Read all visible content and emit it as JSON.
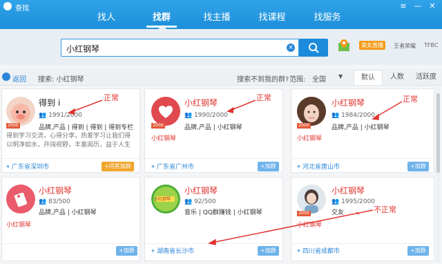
{
  "window": {
    "title": "查找",
    "ctrl_menu": "≡",
    "ctrl_min": "—",
    "ctrl_close": "✕"
  },
  "nav": {
    "tabs": [
      "找人",
      "找群",
      "找主播",
      "找课程",
      "找服务"
    ],
    "active": "找群"
  },
  "search": {
    "value": "小红钢琴",
    "clear_icon": "×"
  },
  "top_right": {
    "live": "美女直播",
    "hot1": "王者荣耀",
    "hot2": "TFBC"
  },
  "filter": {
    "back": "返回",
    "keyword": "搜索: 小红钢琴",
    "no_result": "搜索不到我的群?",
    "range_label": "范围:",
    "range_value": "全国",
    "sort_tabs": [
      "默认",
      "人数",
      "活跃度"
    ]
  },
  "cards": [
    {
      "name": "得到 i",
      "members": "1991/2000",
      "tags": "品牌,产品 | 得到 | 得到 | 得到专栏",
      "desc": "得到学习交流，心得分享，热爱学习让我们得以明净如水，开阔视野，丰富阅历，益于人生",
      "location": "广东省深圳市",
      "button": "+问答加群",
      "level": "2000"
    },
    {
      "name": "小红钢琴",
      "members": "1990/2000",
      "tags": "品牌,产品 | 小红钢琴",
      "location": "广东省广州市",
      "button": "+加群",
      "label": "小红钢琴",
      "level": "2000"
    },
    {
      "name": "小红钢琴",
      "members": "1984/2000",
      "tags": "品牌,产品 | 小红钢琴",
      "location": "河北省唐山市",
      "button": "+加群",
      "label": "小红钢琴",
      "level": "2000"
    },
    {
      "name": "小红钢琴",
      "members": "83/500",
      "tags": "品牌,产品 | 小红钢琴",
      "location": "",
      "button": "+加群",
      "label": "小红钢琴"
    },
    {
      "name": "小红钢琴",
      "members": "92/500",
      "tags": "音乐 | QQ群赚钱 | 小红钢琴",
      "location": "湖南省长沙市",
      "button": "+加群",
      "thumb_text": "小红钢琴"
    },
    {
      "name": "小红钢琴",
      "members": "1995/2000",
      "tags": "交友",
      "location": "四川省成都市",
      "button": "+加群",
      "label": "小红钢琴",
      "level": "2000"
    }
  ],
  "annotations": {
    "ok1": "正常",
    "ok2": "正常",
    "ok3": "正常",
    "bad": "不正常"
  },
  "colors": {
    "primary": "#1d8bdb",
    "accent_red": "#e0342f",
    "orange": "#f0a52c"
  }
}
